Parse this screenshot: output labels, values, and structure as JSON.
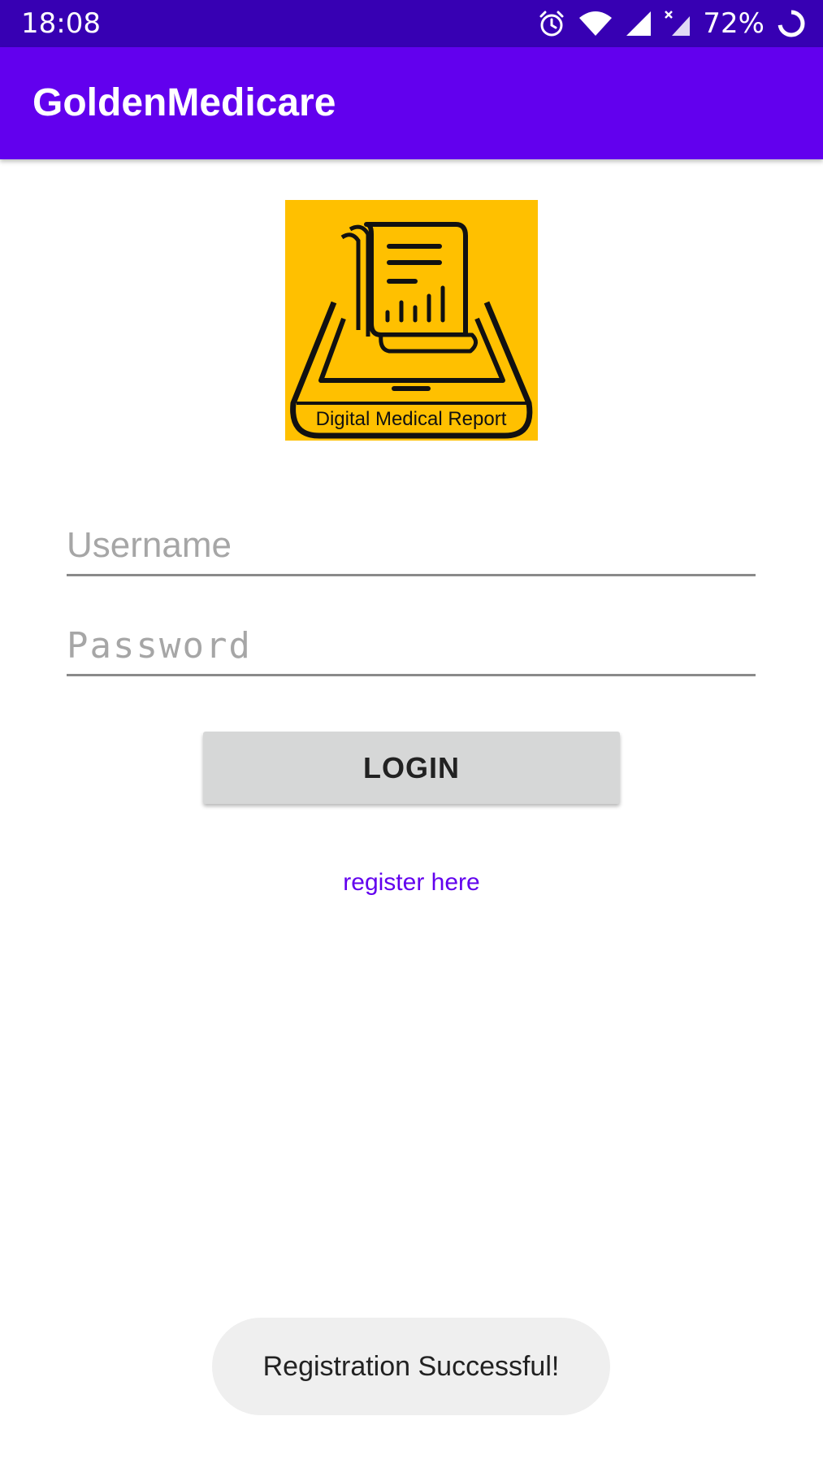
{
  "status_bar": {
    "time": "18:08",
    "battery_percent": "72%",
    "icons": [
      "alarm-icon",
      "wifi-icon",
      "signal-icon",
      "signal-no-data-icon",
      "battery-ring-icon"
    ]
  },
  "app_bar": {
    "title": "GoldenMedicare",
    "color": "#6200ee"
  },
  "logo": {
    "caption": "Digital Medical Report",
    "background": "#ffc000"
  },
  "login_form": {
    "username_placeholder": "Username",
    "username_value": "",
    "password_placeholder": "Password",
    "password_value": "",
    "login_label": "LOGIN",
    "register_link": "register here"
  },
  "toast": {
    "message": "Registration Successful!"
  }
}
